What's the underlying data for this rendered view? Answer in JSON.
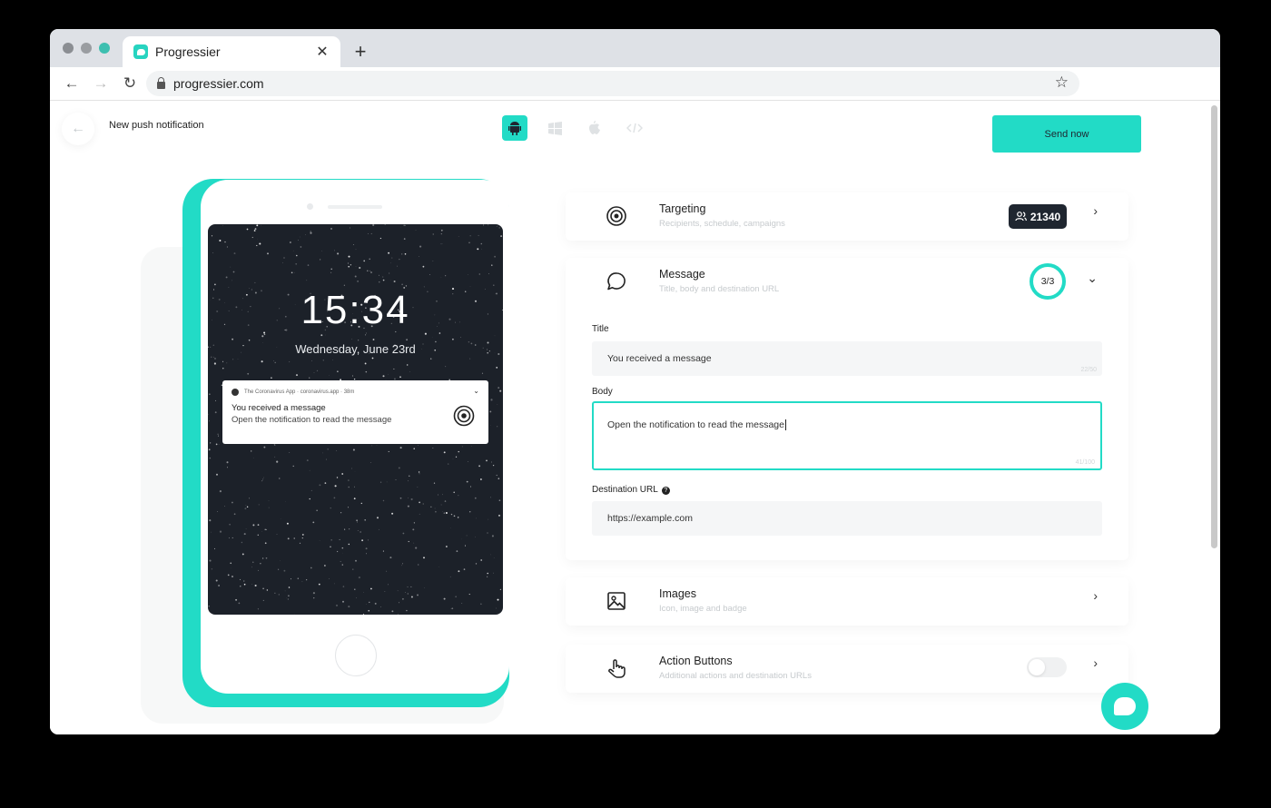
{
  "browser": {
    "tab_title": "Progressier",
    "url": "progressier.com"
  },
  "header": {
    "title": "New push notification",
    "platforms": [
      "android-icon",
      "windows-icon",
      "apple-icon",
      "code-icon"
    ],
    "active_platform": "android",
    "send_label": "Send now"
  },
  "preview": {
    "time": "15:34",
    "date": "Wednesday, June 23rd",
    "notification": {
      "header": "The Coronavirus App · coronavirus.app · 38m",
      "title": "You received a message",
      "body": "Open the notification to read the message"
    }
  },
  "panels": {
    "targeting": {
      "title": "Targeting",
      "subtitle": "Recipients, schedule, campaigns",
      "count": "21340"
    },
    "message": {
      "title": "Message",
      "subtitle": "Title, body and destination URL",
      "progress": "3/3",
      "title_label": "Title",
      "title_value": "You received a message",
      "title_counter": "22/50",
      "body_label": "Body",
      "body_value": "Open the notification to read the message",
      "body_counter": "41/100",
      "url_label": "Destination URL",
      "url_value": "https://example.com"
    },
    "images": {
      "title": "Images",
      "subtitle": "Icon, image and badge"
    },
    "actions": {
      "title": "Action Buttons",
      "subtitle": "Additional actions and destination URLs",
      "enabled": false
    }
  },
  "colors": {
    "accent": "#22dbc6",
    "dark": "#1f2630",
    "phone_screen": "#1c2129"
  }
}
